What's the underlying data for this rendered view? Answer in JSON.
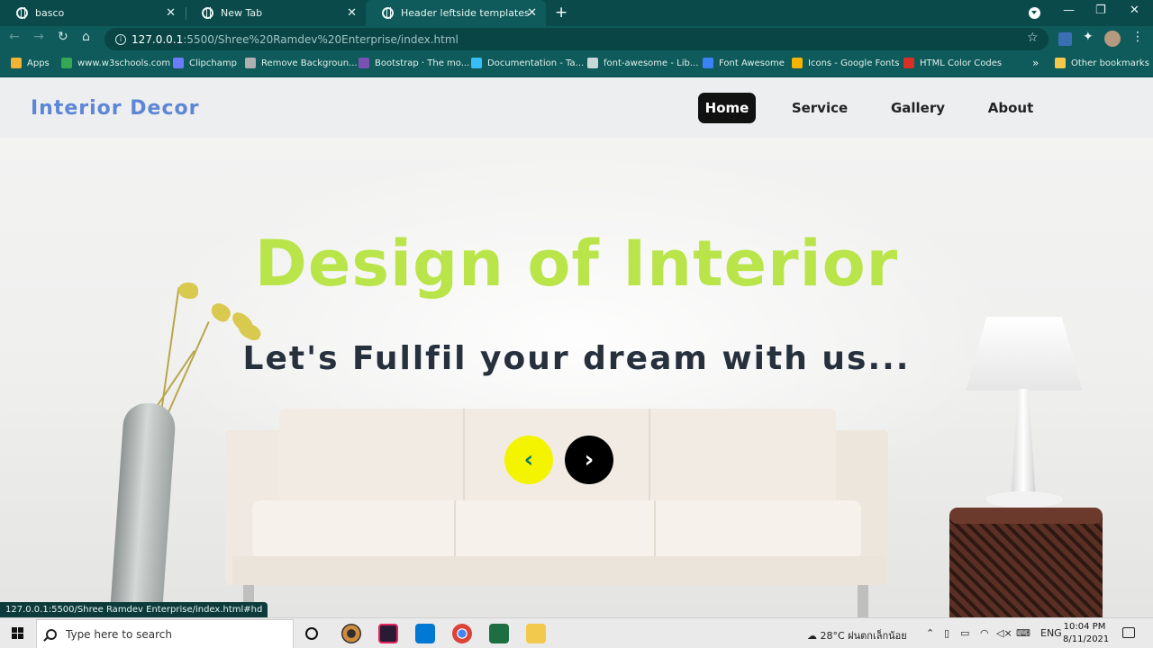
{
  "browser": {
    "tabs": [
      {
        "title": "basco"
      },
      {
        "title": "New Tab"
      },
      {
        "title": "Header leftside templates"
      }
    ],
    "new_tab_glyph": "+",
    "url_host": "127.0.0.1",
    "url_path": ":5500/Shree%20Ramdev%20Enterprise/index.html",
    "bookmarks": [
      {
        "label": "Apps",
        "color": "#f2b233"
      },
      {
        "label": "www.w3schools.com",
        "color": "#34a853"
      },
      {
        "label": "Clipchamp",
        "color": "#6b7cff"
      },
      {
        "label": "Remove Backgroun...",
        "color": "#b0b0b0"
      },
      {
        "label": "Bootstrap · The mo...",
        "color": "#7952b3"
      },
      {
        "label": "Documentation - Ta...",
        "color": "#38bdf8"
      },
      {
        "label": "font-awesome - Lib...",
        "color": "#c8d8d8"
      },
      {
        "label": "Font Awesome",
        "color": "#3b82f6"
      },
      {
        "label": "Icons - Google Fonts",
        "color": "#f4b400"
      },
      {
        "label": "HTML Color Codes",
        "color": "#d93025"
      }
    ],
    "bookmarks_overflow": "»",
    "other_bookmarks": "Other bookmarks",
    "status_url": "127.0.0.1:5500/Shree Ramdev Enterprise/index.html#hd"
  },
  "site": {
    "logo": "Interior Decor",
    "nav": [
      "Home",
      "Service",
      "Gallery",
      "About"
    ],
    "active_nav": "Home",
    "hero_title": "Design of Interior",
    "hero_subtitle": "Let's Fullfil your dream with us...",
    "prev_glyph": "‹",
    "next_glyph": "›",
    "colors": {
      "logo": "#5d86d6",
      "hero_title": "#b9e54a",
      "prev_button": "#f4f400",
      "next_button": "#000000"
    }
  },
  "taskbar": {
    "search_placeholder": "Type here to search",
    "apps": [
      "obs-studio",
      "media-app",
      "vscode",
      "chrome",
      "excel",
      "file-explorer"
    ],
    "weather": "28°C  ฝนตกเล็กน้อย",
    "language": "ENG",
    "time": "10:04 PM",
    "date": "8/11/2021"
  }
}
